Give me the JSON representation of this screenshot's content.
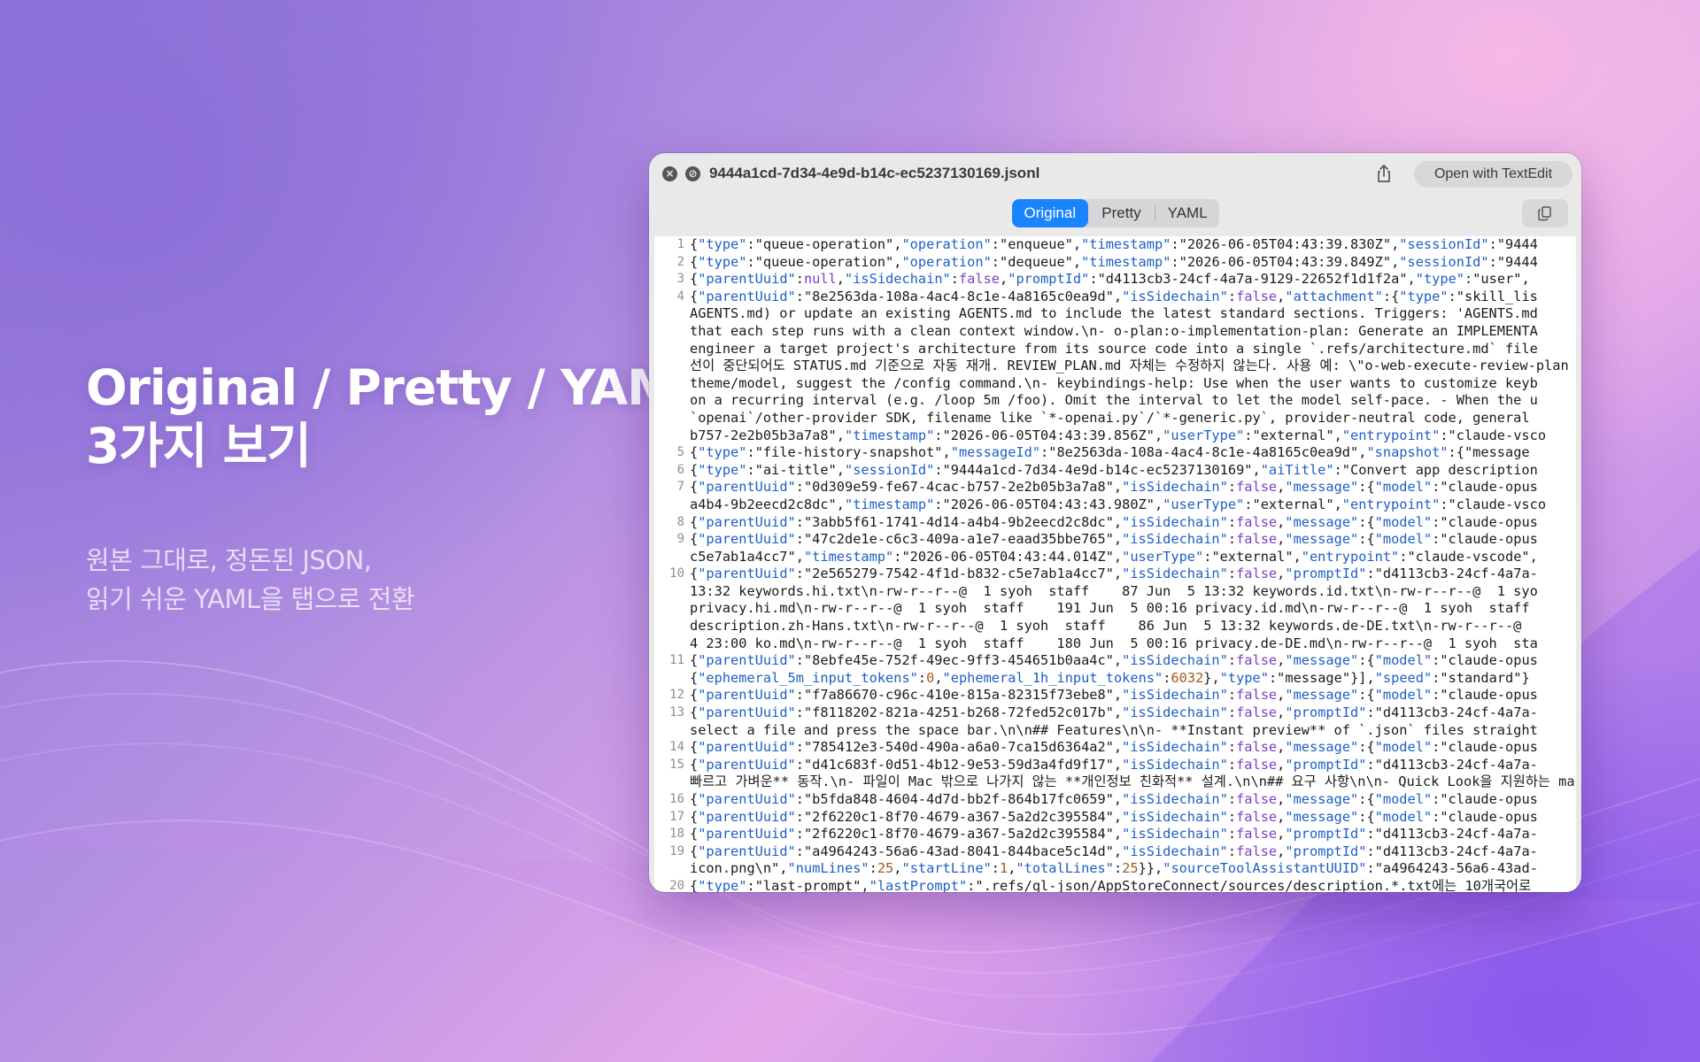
{
  "hero": {
    "title_line1": "Original / Pretty / YAML",
    "title_line2": "3가지 보기",
    "subtitle_line1": "원본 그대로, 정돈된 JSON,",
    "subtitle_line2": "읽기 쉬운 YAML을 탭으로 전환"
  },
  "window": {
    "file_name": "9444a1cd-7d34-4e9d-b14c-ec5237130169.jsonl",
    "open_button": "Open with TextEdit",
    "close_icon": "×",
    "block_icon": "⊘",
    "tabs": [
      "Original",
      "Pretty",
      "YAML"
    ],
    "active_tab": "Original"
  },
  "colors": {
    "accent": "#1a84ff",
    "json_key": "#1d5fc4",
    "json_bool": "#7b3fc8",
    "json_number": "#a3581b",
    "line_number": "#8e8e93"
  },
  "icons": [
    "close-icon",
    "block-icon",
    "share-icon",
    "copy-icon"
  ],
  "editor": {
    "lines": [
      {
        "n": "1",
        "t": "{\"type\":\"queue-operation\",\"operation\":\"enqueue\",\"timestamp\":\"2026-06-05T04:43:39.830Z\",\"sessionId\":\"9444"
      },
      {
        "n": "2",
        "t": "{\"type\":\"queue-operation\",\"operation\":\"dequeue\",\"timestamp\":\"2026-06-05T04:43:39.849Z\",\"sessionId\":\"9444"
      },
      {
        "n": "3",
        "t": "{\"parentUuid\":null,\"isSidechain\":false,\"promptId\":\"d4113cb3-24cf-4a7a-9129-22652f1d1f2a\",\"type\":\"user\","
      },
      {
        "n": "4",
        "t": "{\"parentUuid\":\"8e2563da-108a-4ac4-8c1e-4a8165c0ea9d\",\"isSidechain\":false,\"attachment\":{\"type\":\"skill_lis"
      },
      {
        "n": "",
        "t": "AGENTS.md) or update an existing AGENTS.md to include the latest standard sections. Triggers: 'AGENTS.md"
      },
      {
        "n": "",
        "t": "that each step runs with a clean context window.\\n- o-plan:o-implementation-plan: Generate an IMPLEMENTA"
      },
      {
        "n": "",
        "t": "engineer a target project's architecture from its source code into a single `.refs/architecture.md` file"
      },
      {
        "n": "",
        "t": "선이 중단되어도 STATUS.md 기준으로 자동 재개. REVIEW_PLAN.md 자체는 수정하지 않는다. 사용 예: \\\"o-web-execute-review-plan"
      },
      {
        "n": "",
        "t": "theme/model, suggest the /config command.\\n- keybindings-help: Use when the user wants to customize keyb"
      },
      {
        "n": "",
        "t": "on a recurring interval (e.g. /loop 5m /foo). Omit the interval to let the model self-pace. - When the u"
      },
      {
        "n": "",
        "t": "`openai`/other-provider SDK, filename like `*-openai.py`/`*-generic.py`, provider-neutral code, general"
      },
      {
        "n": "",
        "t": "b757-2e2b05b3a7a8\",\"timestamp\":\"2026-06-05T04:43:39.856Z\",\"userType\":\"external\",\"entrypoint\":\"claude-vsco"
      },
      {
        "n": "5",
        "t": "{\"type\":\"file-history-snapshot\",\"messageId\":\"8e2563da-108a-4ac4-8c1e-4a8165c0ea9d\",\"snapshot\":{\"message"
      },
      {
        "n": "6",
        "t": "{\"type\":\"ai-title\",\"sessionId\":\"9444a1cd-7d34-4e9d-b14c-ec5237130169\",\"aiTitle\":\"Convert app description"
      },
      {
        "n": "7",
        "t": "{\"parentUuid\":\"0d309e59-fe67-4cac-b757-2e2b05b3a7a8\",\"isSidechain\":false,\"message\":{\"model\":\"claude-opus"
      },
      {
        "n": "",
        "t": "a4b4-9b2eecd2c8dc\",\"timestamp\":\"2026-06-05T04:43:43.980Z\",\"userType\":\"external\",\"entrypoint\":\"claude-vsco"
      },
      {
        "n": "8",
        "t": "{\"parentUuid\":\"3abb5f61-1741-4d14-a4b4-9b2eecd2c8dc\",\"isSidechain\":false,\"message\":{\"model\":\"claude-opus"
      },
      {
        "n": "9",
        "t": "{\"parentUuid\":\"47c2de1e-c6c3-409a-a1e7-eaad35bbe765\",\"isSidechain\":false,\"message\":{\"model\":\"claude-opus"
      },
      {
        "n": "",
        "t": "c5e7ab1a4cc7\",\"timestamp\":\"2026-06-05T04:43:44.014Z\",\"userType\":\"external\",\"entrypoint\":\"claude-vscode\","
      },
      {
        "n": "10",
        "t": "{\"parentUuid\":\"2e565279-7542-4f1d-b832-c5e7ab1a4cc7\",\"isSidechain\":false,\"promptId\":\"d4113cb3-24cf-4a7a-"
      },
      {
        "n": "",
        "t": "13:32 keywords.hi.txt\\n-rw-r--r--@  1 syoh  staff    87 Jun  5 13:32 keywords.id.txt\\n-rw-r--r--@  1 syo"
      },
      {
        "n": "",
        "t": "privacy.hi.md\\n-rw-r--r--@  1 syoh  staff    191 Jun  5 00:16 privacy.id.md\\n-rw-r--r--@  1 syoh  staff"
      },
      {
        "n": "",
        "t": "description.zh-Hans.txt\\n-rw-r--r--@  1 syoh  staff    86 Jun  5 13:32 keywords.de-DE.txt\\n-rw-r--r--@"
      },
      {
        "n": "",
        "t": "4 23:00 ko.md\\n-rw-r--r--@  1 syoh  staff    180 Jun  5 00:16 privacy.de-DE.md\\n-rw-r--r--@  1 syoh  sta"
      },
      {
        "n": "11",
        "t": "{\"parentUuid\":\"8ebfe45e-752f-49ec-9ff3-454651b0aa4c\",\"isSidechain\":false,\"message\":{\"model\":\"claude-opus"
      },
      {
        "n": "",
        "t": "{\"ephemeral_5m_input_tokens\":0,\"ephemeral_1h_input_tokens\":6032},\"type\":\"message\"}],\"speed\":\"standard\"}"
      },
      {
        "n": "12",
        "t": "{\"parentUuid\":\"f7a86670-c96c-410e-815a-82315f73ebe8\",\"isSidechain\":false,\"message\":{\"model\":\"claude-opus"
      },
      {
        "n": "13",
        "t": "{\"parentUuid\":\"f8118202-821a-4251-b268-72fed52c017b\",\"isSidechain\":false,\"promptId\":\"d4113cb3-24cf-4a7a-"
      },
      {
        "n": "",
        "t": "select a file and press the space bar.\\n\\n## Features\\n\\n- **Instant preview** of `.json` files straight"
      },
      {
        "n": "14",
        "t": "{\"parentUuid\":\"785412e3-540d-490a-a6a0-7ca15d6364a2\",\"isSidechain\":false,\"message\":{\"model\":\"claude-opus"
      },
      {
        "n": "15",
        "t": "{\"parentUuid\":\"d41c683f-0d51-4b12-9e53-59d3a4fd9f17\",\"isSidechain\":false,\"promptId\":\"d4113cb3-24cf-4a7a-"
      },
      {
        "n": "",
        "t": "빠르고 가벼운** 동작.\\n- 파일이 Mac 밖으로 나가지 않는 **개인정보 친화적** 설계.\\n\\n## 요구 사항\\n\\n- Quick Look을 지원하는 ma"
      },
      {
        "n": "16",
        "t": "{\"parentUuid\":\"b5fda848-4604-4d7d-bb2f-864b17fc0659\",\"isSidechain\":false,\"message\":{\"model\":\"claude-opus"
      },
      {
        "n": "17",
        "t": "{\"parentUuid\":\"2f6220c1-8f70-4679-a367-5a2d2c395584\",\"isSidechain\":false,\"message\":{\"model\":\"claude-opus"
      },
      {
        "n": "18",
        "t": "{\"parentUuid\":\"2f6220c1-8f70-4679-a367-5a2d2c395584\",\"isSidechain\":false,\"promptId\":\"d4113cb3-24cf-4a7a-"
      },
      {
        "n": "19",
        "t": "{\"parentUuid\":\"a4964243-56a6-43ad-8041-844bace5c14d\",\"isSidechain\":false,\"promptId\":\"d4113cb3-24cf-4a7a-"
      },
      {
        "n": "",
        "t": "icon.png\\n\",\"numLines\":25,\"startLine\":1,\"totalLines\":25}},\"sourceToolAssistantUUID\":\"a4964243-56a6-43ad-"
      },
      {
        "n": "20",
        "t": "{\"type\":\"last-prompt\",\"lastPrompt\":\".refs/ql-json/AppStoreConnect/sources/description.*.txt에는 10개국어로"
      }
    ]
  }
}
